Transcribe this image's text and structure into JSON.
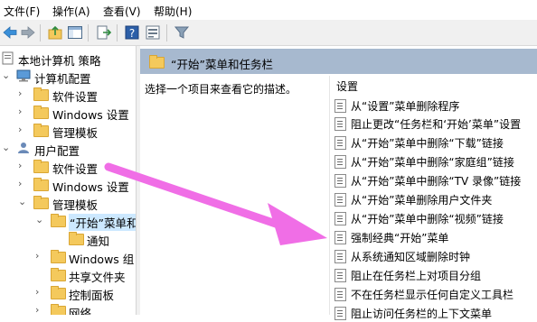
{
  "menu": [
    "文件(F)",
    "操作(A)",
    "查看(V)",
    "帮助(H)"
  ],
  "tree": {
    "root": "本地计算机 策略",
    "computer_config": "计算机配置",
    "cc_software": "软件设置",
    "cc_windows": "Windows 设置",
    "cc_admin": "管理模板",
    "user_config": "用户配置",
    "uc_software": "软件设置",
    "uc_windows": "Windows 设置",
    "uc_admin": "管理模板",
    "start_menu": "“开始”菜单和",
    "notify": "通知",
    "windows_comp": "Windows 组",
    "shared": "共享文件夹",
    "control_panel": "控制面板",
    "network": "网络"
  },
  "right": {
    "header": "“开始”菜单和任务栏",
    "description": "选择一个项目来查看它的描述。",
    "column": "设置",
    "settings": [
      "从“设置”菜单删除程序",
      "阻止更改“任务栏和‘开始’菜单”设置",
      "从“开始”菜单中删除“下载”链接",
      "从“开始”菜单中删除“家庭组”链接",
      "从“开始”菜单中删除“TV 录像”链接",
      "从“开始”菜单删除用户文件夹",
      "从“开始”菜单中删除“视频”链接",
      "强制经典“开始”菜单",
      "从系统通知区域删除时钟",
      "阻止在任务栏上对项目分组",
      "不在任务栏显示任何自定义工具栏",
      "阻止访问任务栏的上下文菜单"
    ]
  },
  "annotation_color": "#f06ee6"
}
